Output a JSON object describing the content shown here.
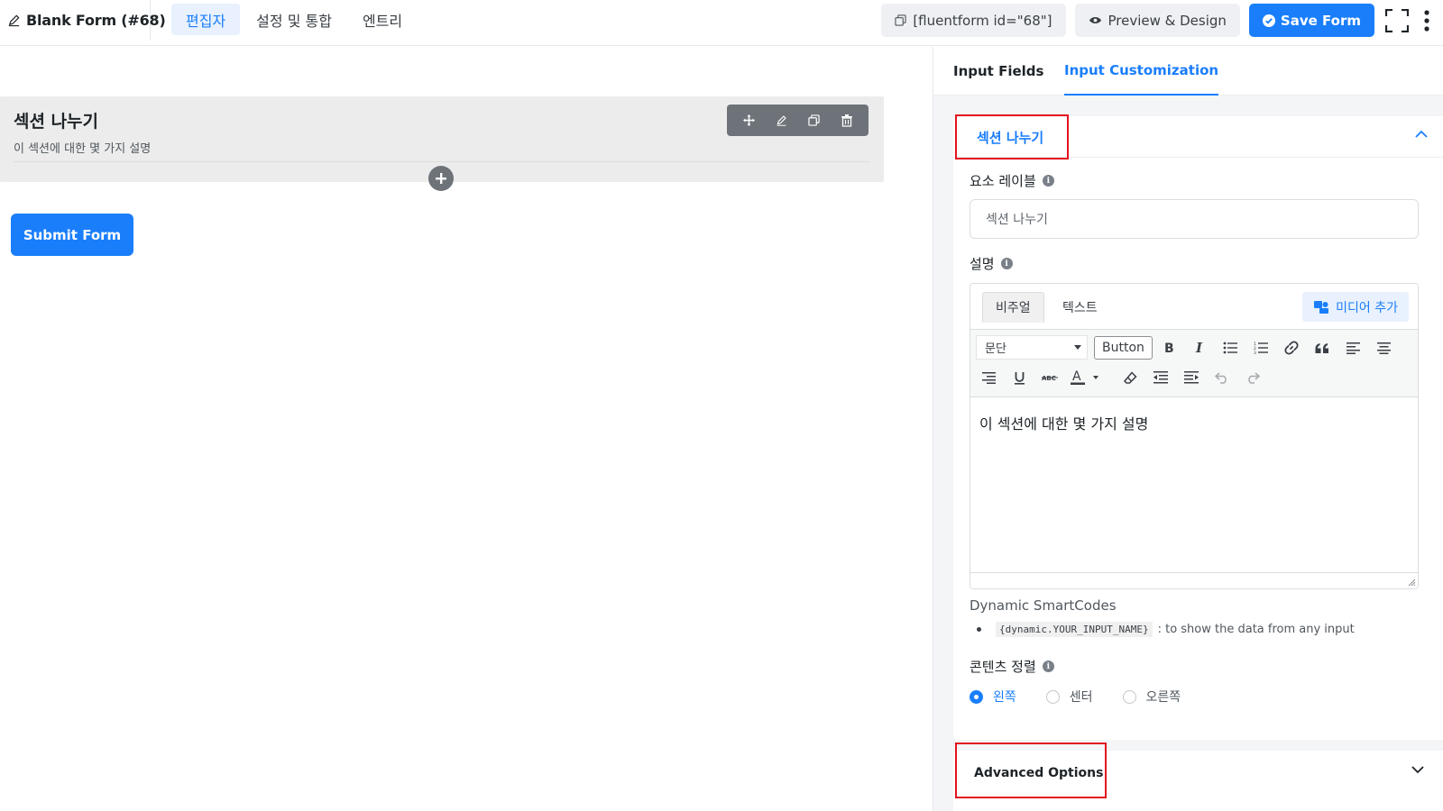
{
  "header": {
    "form_title": "Blank Form (#68)",
    "nav_tabs": [
      {
        "label": "편집자",
        "active": true
      },
      {
        "label": "설정 및 통합",
        "active": false
      },
      {
        "label": "엔트리",
        "active": false
      }
    ],
    "shortcode": "[fluentform id=\"68\"]",
    "preview_label": "Preview & Design",
    "save_label": "Save Form"
  },
  "canvas": {
    "section_title": "섹션 나누기",
    "section_description": "이 섹션에 대한 몇 가지 설명",
    "submit_label": "Submit Form"
  },
  "panel": {
    "tabs": [
      {
        "label": "Input Fields",
        "active": false
      },
      {
        "label": "Input Customization",
        "active": true
      }
    ],
    "card_title": "섹션 나누기",
    "element_label": {
      "label": "요소 레이블",
      "value": "섹션 나누기"
    },
    "description": {
      "label": "설명",
      "mode_visual": "비주얼",
      "mode_text": "텍스트",
      "add_media": "미디어 추가",
      "format_select": "문단",
      "button_label": "Button",
      "content": "이 섹션에 대한 몇 가지 설명"
    },
    "smartcodes": {
      "title": "Dynamic SmartCodes",
      "code": "{dynamic.YOUR_INPUT_NAME}",
      "note": ": to show the data from any input"
    },
    "alignment": {
      "label": "콘텐츠 정렬",
      "options": [
        {
          "label": "왼쪽",
          "selected": true
        },
        {
          "label": "센터",
          "selected": false
        },
        {
          "label": "오른쪽",
          "selected": false
        }
      ]
    },
    "advanced_title": "Advanced Options"
  },
  "colors": {
    "primary": "#1a7efb",
    "highlight_border": "#e3131e",
    "toolbar_grey": "#6e7379"
  },
  "icons": [
    "edit-pencil-icon",
    "copy-icon",
    "eye-icon",
    "check-circle-icon",
    "fullscreen-icon",
    "kebab-menu-icon",
    "move-icon",
    "pencil-icon",
    "duplicate-icon",
    "trash-icon",
    "plus-icon",
    "chevron-up-icon",
    "chevron-down-icon",
    "info-icon",
    "media-icon",
    "bold-icon",
    "italic-icon",
    "bullet-list-icon",
    "numbered-list-icon",
    "link-icon",
    "blockquote-icon",
    "align-left-icon",
    "align-center-icon",
    "align-right-icon",
    "underline-icon",
    "strikethrough-icon",
    "text-color-icon",
    "eraser-icon",
    "outdent-icon",
    "indent-icon",
    "undo-icon",
    "redo-icon"
  ]
}
